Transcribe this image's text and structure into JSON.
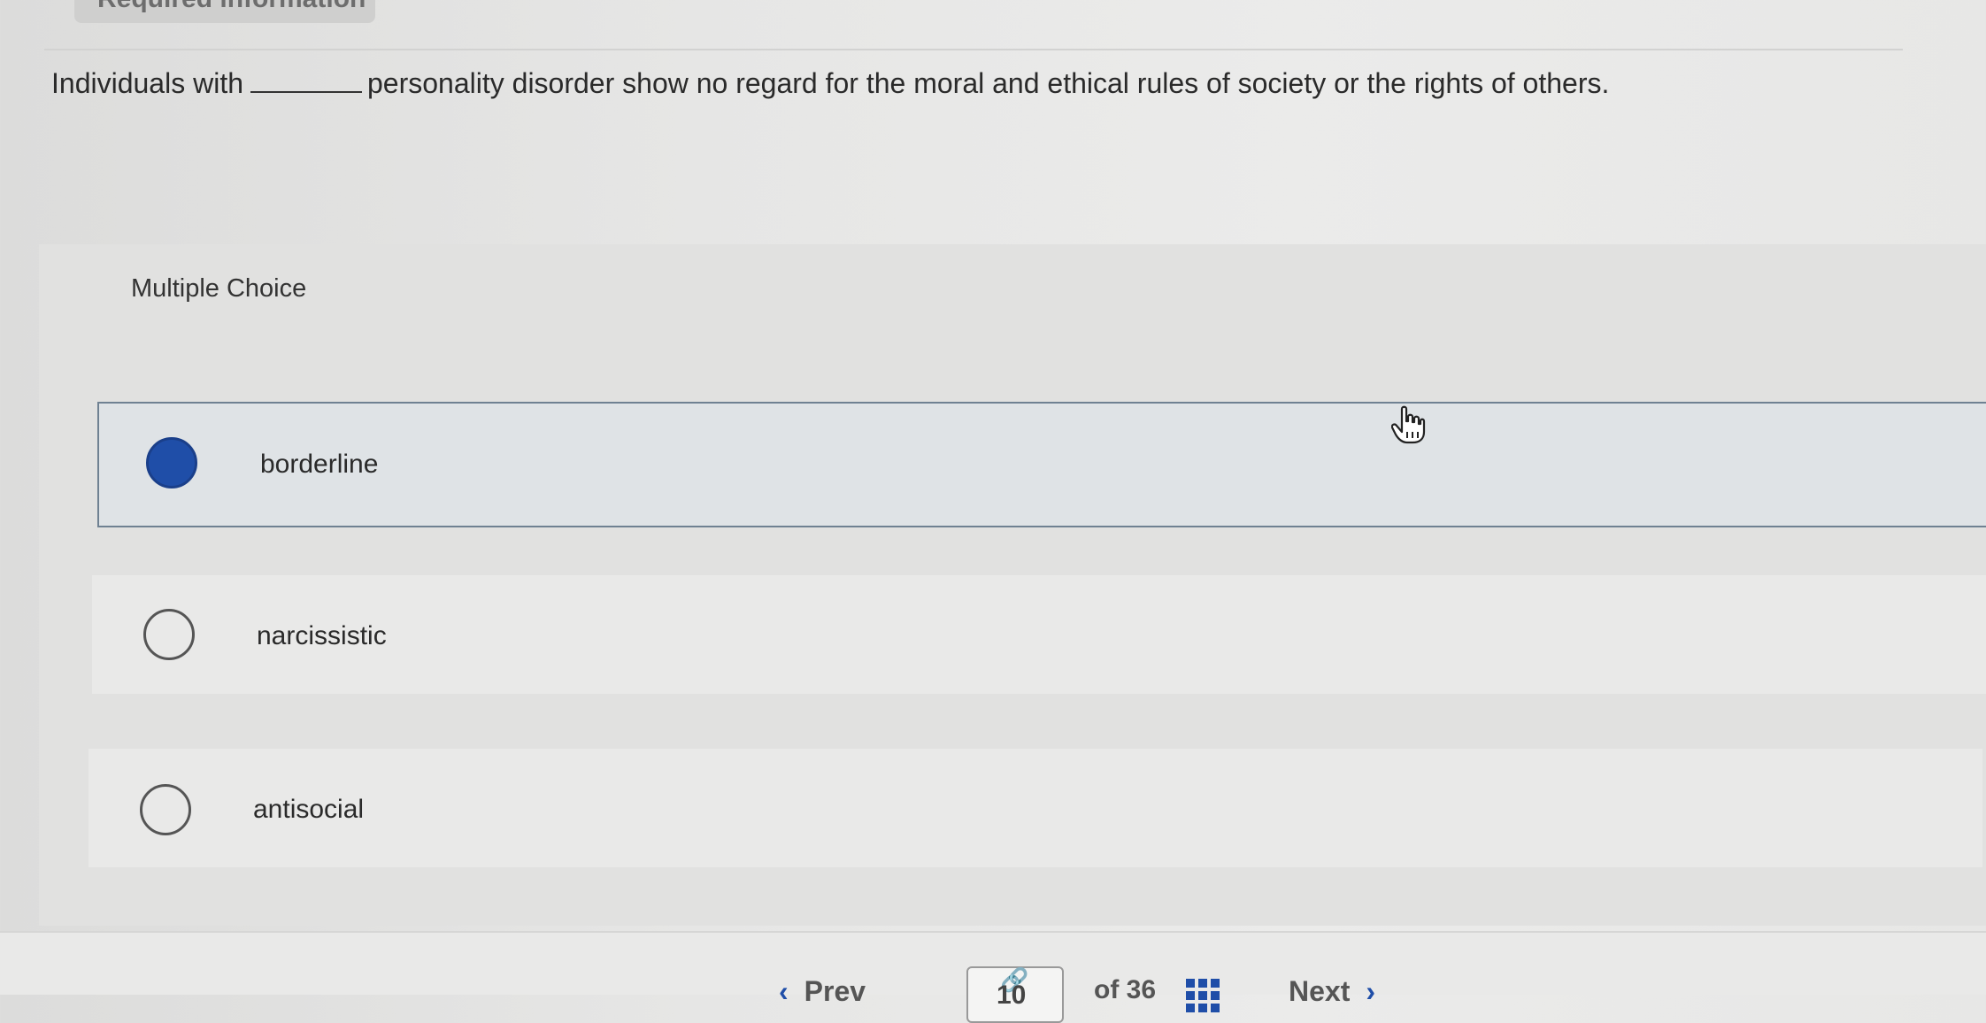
{
  "header": {
    "tab_label": "Required information"
  },
  "question": {
    "text_before": "Individuals with",
    "text_after": "personality disorder show no regard for the moral and ethical rules of society or the rights of others."
  },
  "choices": {
    "heading": "Multiple Choice",
    "options": [
      {
        "label": "borderline",
        "selected": true
      },
      {
        "label": "narcissistic",
        "selected": false
      },
      {
        "label": "antisocial",
        "selected": false
      }
    ]
  },
  "footer": {
    "prev_label": "Prev",
    "current_page": "10",
    "of_text": "of 36",
    "next_label": "Next",
    "link_icon": "link-icon",
    "grid_icon": "grid-icon"
  },
  "colors": {
    "accent": "#1f4ea8",
    "selected_border": "#6f8192"
  }
}
